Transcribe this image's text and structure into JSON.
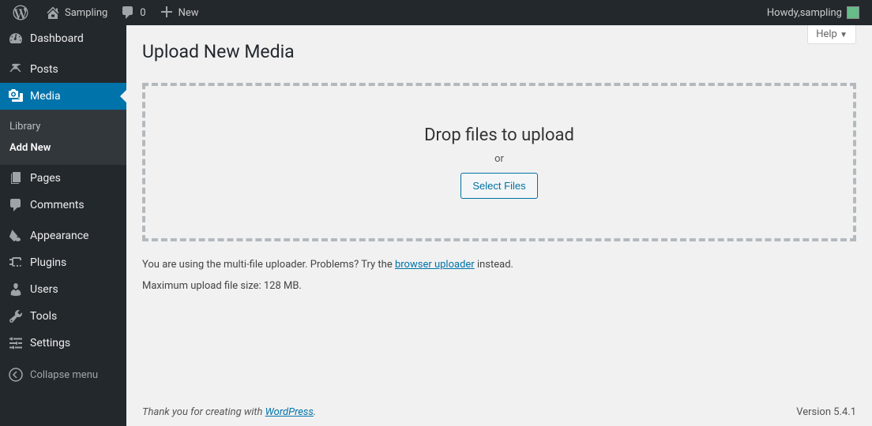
{
  "adminbar": {
    "site_name": "Sampling",
    "comments_count": "0",
    "new_label": "New",
    "howdy_prefix": "Howdy, ",
    "user_name": "sampling"
  },
  "sidebar": {
    "dashboard": "Dashboard",
    "posts": "Posts",
    "media": "Media",
    "media_submenu": {
      "library": "Library",
      "add_new": "Add New"
    },
    "pages": "Pages",
    "comments": "Comments",
    "appearance": "Appearance",
    "plugins": "Plugins",
    "users": "Users",
    "tools": "Tools",
    "settings": "Settings",
    "collapse": "Collapse menu"
  },
  "screen": {
    "help": "Help",
    "title": "Upload New Media",
    "drop_instructions": "Drop files to upload",
    "or": "or",
    "select_files": "Select Files",
    "info_prefix": "You are using the multi-file uploader. Problems? Try the ",
    "info_link": "browser uploader",
    "info_suffix": " instead.",
    "max_size": "Maximum upload file size: 128 MB."
  },
  "footer": {
    "thanks_prefix": "Thank you for creating with ",
    "thanks_link": "WordPress",
    "thanks_suffix": ".",
    "version": "Version 5.4.1"
  }
}
